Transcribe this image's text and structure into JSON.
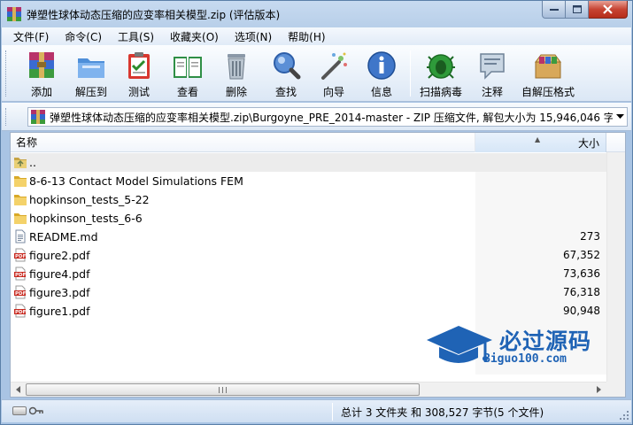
{
  "window": {
    "title": "弹塑性球体动态压缩的应变率相关模型.zip (评估版本)"
  },
  "menu": [
    "文件(F)",
    "命令(C)",
    "工具(S)",
    "收藏夹(O)",
    "选项(N)",
    "帮助(H)"
  ],
  "toolbar": {
    "add": "添加",
    "extract": "解压到",
    "test": "测试",
    "view": "查看",
    "delete": "删除",
    "find": "查找",
    "wizard": "向导",
    "info": "信息",
    "scan": "扫描病毒",
    "comment": "注释",
    "sfx": "自解压格式"
  },
  "address": {
    "path": "弹塑性球体动态压缩的应变率相关模型.zip\\Burgoyne_PRE_2014-master - ZIP 压缩文件, 解包大小为 15,946,046 字节"
  },
  "columns": {
    "name": "名称",
    "size": "大小"
  },
  "files": [
    {
      "name": "..",
      "size": "",
      "icon": "parent-folder-icon"
    },
    {
      "name": "8-6-13 Contact Model Simulations FEM",
      "size": "",
      "icon": "folder-icon"
    },
    {
      "name": "hopkinson_tests_5-22",
      "size": "",
      "icon": "folder-icon"
    },
    {
      "name": "hopkinson_tests_6-6",
      "size": "",
      "icon": "folder-icon"
    },
    {
      "name": "README.md",
      "size": "273",
      "icon": "text-file-icon"
    },
    {
      "name": "figure2.pdf",
      "size": "67,352",
      "icon": "pdf-icon"
    },
    {
      "name": "figure4.pdf",
      "size": "73,636",
      "icon": "pdf-icon"
    },
    {
      "name": "figure3.pdf",
      "size": "76,318",
      "icon": "pdf-icon"
    },
    {
      "name": "figure1.pdf",
      "size": "90,948",
      "icon": "pdf-icon"
    }
  ],
  "pdf_badge": "PDF",
  "watermark": {
    "title": "必过源码",
    "url": "Biguo100.com"
  },
  "status": {
    "summary": "总计 3 文件夹 和 308,527 字节(5 个文件)"
  },
  "colors": {
    "title_bg": "#c7daf0",
    "toolbar_bg": "#dbe7f5",
    "close_button": "#c74433",
    "watermark": "#1f63b5"
  }
}
